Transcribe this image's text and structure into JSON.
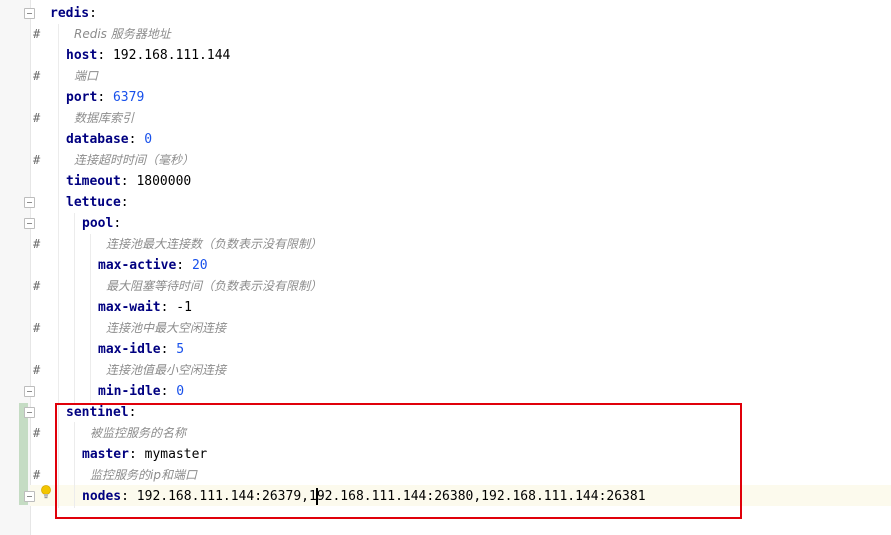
{
  "gutter": {
    "comment_marker": "#"
  },
  "lines": [
    {
      "key": "redis",
      "sep": ":",
      "value": "",
      "vtype": "none"
    },
    {
      "comment": "Redis 服务器地址"
    },
    {
      "key": "host",
      "sep": ":",
      "value": "192.168.111.144",
      "vtype": "str"
    },
    {
      "comment": "端口"
    },
    {
      "key": "port",
      "sep": ":",
      "value": "6379",
      "vtype": "num"
    },
    {
      "comment": "数据库索引"
    },
    {
      "key": "database",
      "sep": ":",
      "value": "0",
      "vtype": "num"
    },
    {
      "comment": "连接超时时间（毫秒）"
    },
    {
      "key": "timeout",
      "sep": ":",
      "value": "1800000",
      "vtype": "str"
    },
    {
      "key": "lettuce",
      "sep": ":",
      "value": "",
      "vtype": "none"
    },
    {
      "key": "pool",
      "sep": ":",
      "value": "",
      "vtype": "none"
    },
    {
      "comment": "连接池最大连接数（负数表示没有限制）"
    },
    {
      "key": "max-active",
      "sep": ":",
      "value": "20",
      "vtype": "num"
    },
    {
      "comment": "最大阻塞等待时间（负数表示没有限制）"
    },
    {
      "key": "max-wait",
      "sep": ":",
      "value": "-1",
      "vtype": "str"
    },
    {
      "comment": "连接池中最大空闲连接"
    },
    {
      "key": "max-idle",
      "sep": ":",
      "value": "5",
      "vtype": "num"
    },
    {
      "comment": "连接池值最小空闲连接"
    },
    {
      "key": "min-idle",
      "sep": ":",
      "value": "0",
      "vtype": "num"
    },
    {
      "key": "sentinel",
      "sep": ":",
      "value": "",
      "vtype": "none"
    },
    {
      "comment": "被监控服务的名称"
    },
    {
      "key": "master",
      "sep": ":",
      "value": "mymaster",
      "vtype": "str"
    },
    {
      "comment": "监控服务的ip和端口"
    },
    {
      "key": "nodes",
      "sep": ":",
      "value_a": "192.168.111.144:26379,1",
      "value_b": "92.168.111.144:26380,192.168.111.144:26381",
      "vtype": "split"
    }
  ]
}
